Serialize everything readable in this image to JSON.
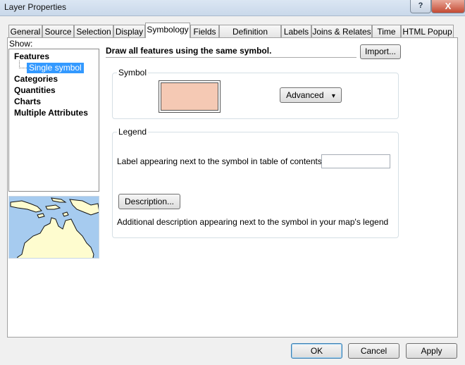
{
  "window": {
    "title": "Layer Properties",
    "help_glyph": "?",
    "close_glyph": "X"
  },
  "tabs": [
    {
      "label": "General"
    },
    {
      "label": "Source"
    },
    {
      "label": "Selection"
    },
    {
      "label": "Display"
    },
    {
      "label": "Symbology"
    },
    {
      "label": "Fields"
    },
    {
      "label": "Definition Query"
    },
    {
      "label": "Labels"
    },
    {
      "label": "Joins & Relates"
    },
    {
      "label": "Time"
    },
    {
      "label": "HTML Popup"
    }
  ],
  "active_tab": "Symbology",
  "show": {
    "label": "Show:",
    "items": [
      {
        "label": "Features"
      },
      {
        "label": "Single symbol",
        "selected": true
      },
      {
        "label": "Categories"
      },
      {
        "label": "Quantities"
      },
      {
        "label": "Charts"
      },
      {
        "label": "Multiple Attributes"
      }
    ]
  },
  "main": {
    "heading": "Draw all features using the same symbol.",
    "import_label": "Import...",
    "symbol_group_label": "Symbol",
    "symbol_fill_color": "#f5c9b4",
    "advanced_label": "Advanced",
    "advanced_arrow": "▾",
    "legend_group_label": "Legend",
    "toc_label": "Label appearing next to the symbol in table of contents:",
    "toc_value": "",
    "description_button": "Description...",
    "description_text": "Additional description appearing next to the symbol in your map's legend"
  },
  "footer": {
    "ok": "OK",
    "cancel": "Cancel",
    "apply": "Apply"
  },
  "colors": {
    "accent_selection": "#3399ff",
    "map_water": "#a6cbef",
    "map_land": "#fefccf"
  }
}
